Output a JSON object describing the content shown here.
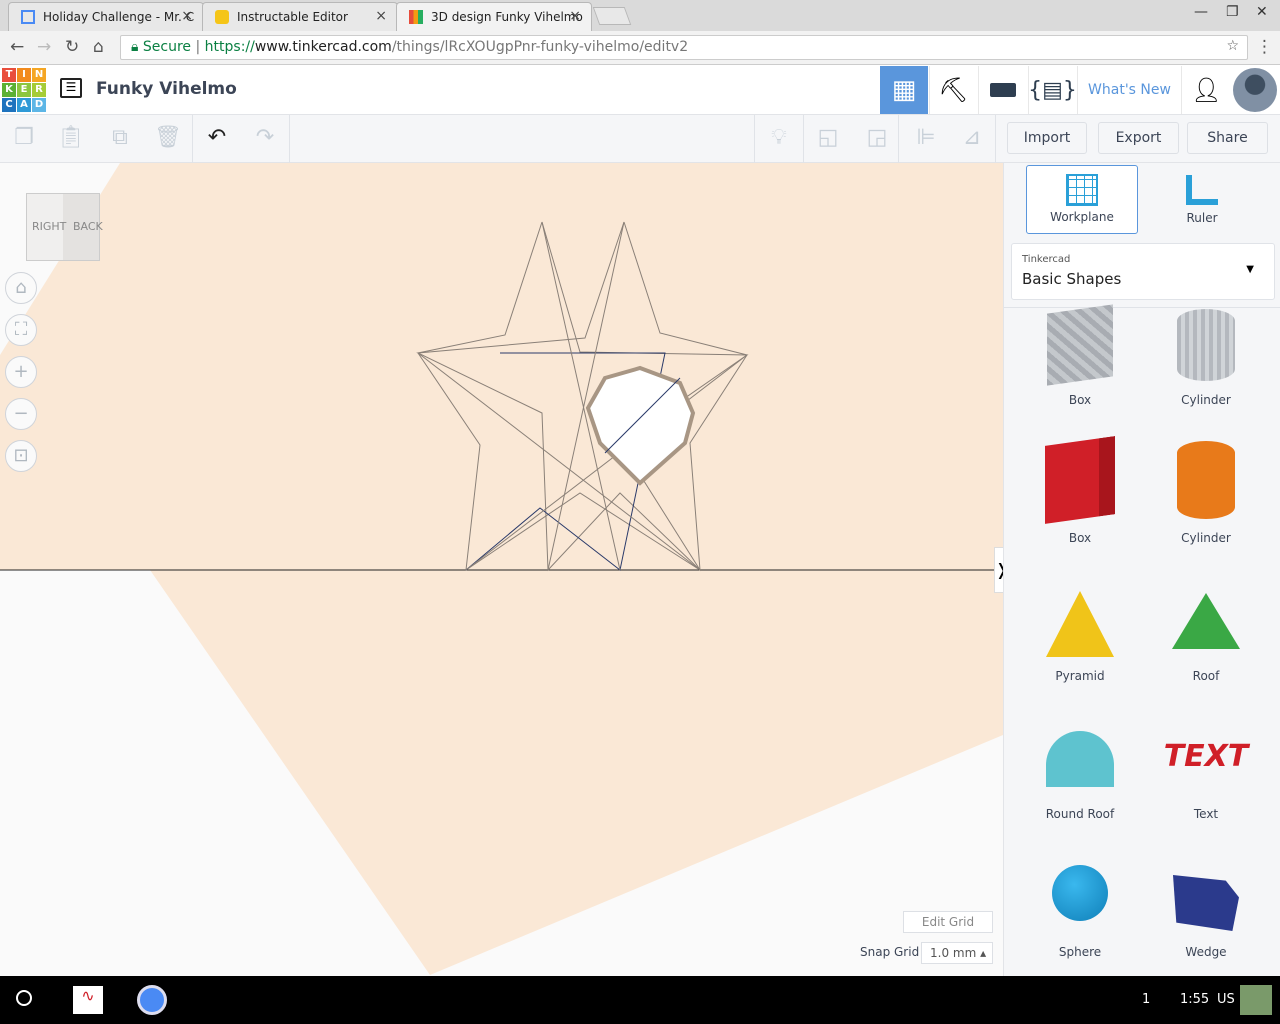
{
  "browser": {
    "tabs": [
      {
        "title": "Holiday Challenge - Mr. C"
      },
      {
        "title": "Instructable Editor"
      },
      {
        "title": "3D design Funky Vihelmo"
      }
    ],
    "secure_label": "Secure",
    "url_scheme": "https://",
    "url_host": "www.tinkercad.com",
    "url_path": "/things/lRcXOUgpPnr-funky-vihelmo/editv2"
  },
  "app": {
    "logo": [
      "T",
      "I",
      "N",
      "K",
      "E",
      "R",
      "C",
      "A",
      "D"
    ],
    "title": "Funky Vihelmo",
    "whats_new": "What's New"
  },
  "toolbar": {
    "import": "Import",
    "export": "Export",
    "share": "Share"
  },
  "viewcube": {
    "right": "RIGHT",
    "back": "BACK"
  },
  "panel": {
    "workplane": "Workplane",
    "ruler": "Ruler",
    "library_source": "Tinkercad",
    "library_name": "Basic Shapes",
    "shapes": [
      {
        "label": "Box",
        "color": "#b0b4ba"
      },
      {
        "label": "Cylinder",
        "color": "#c0c4ca"
      },
      {
        "label": "Box",
        "color": "#d01f28"
      },
      {
        "label": "Cylinder",
        "color": "#e87a1a"
      },
      {
        "label": "Pyramid",
        "color": "#f0c419"
      },
      {
        "label": "Roof",
        "color": "#3aa845"
      },
      {
        "label": "Round Roof",
        "color": "#5ec3cf"
      },
      {
        "label": "Text",
        "color": "#d01f28"
      },
      {
        "label": "Sphere",
        "color": "#1a9ad6"
      },
      {
        "label": "Wedge",
        "color": "#2b3a8c"
      }
    ]
  },
  "grid": {
    "edit_grid": "Edit Grid",
    "snap_label": "Snap Grid",
    "snap_value": "1.0 mm"
  },
  "taskbar": {
    "notifications": "1",
    "time": "1:55",
    "locale": "US"
  }
}
